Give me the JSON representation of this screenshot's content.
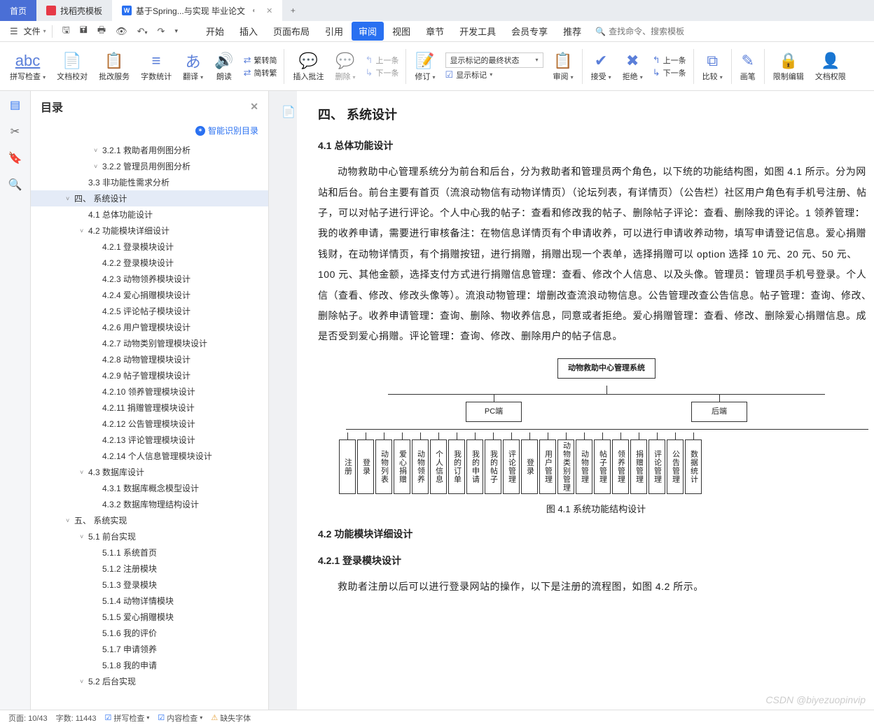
{
  "tabs": {
    "home": "首页",
    "t1": "找稻壳模板",
    "t2": "基于Spring...与实现 毕业论文",
    "indicator": "◐",
    "close": "✕",
    "new": "+"
  },
  "menubar": {
    "file": "文件",
    "items": [
      "开始",
      "插入",
      "页面布局",
      "引用",
      "审阅",
      "视图",
      "章节",
      "开发工具",
      "会员专享",
      "推荐"
    ],
    "active_index": 4,
    "search_placeholder": "查找命令、搜索模板"
  },
  "ribbon": {
    "spellcheck": "拼写检查",
    "proofread": "文档校对",
    "approve": "批改服务",
    "wordcount": "字数统计",
    "translate": "翻译",
    "read": "朗读",
    "convert": {
      "zh2tw": "繁转简",
      "tw2zh": "简转繁"
    },
    "insert_comment": "插入批注",
    "delete": "删除",
    "prev_comment": "上一条",
    "next_comment": "下一条",
    "revise": "修订",
    "markup_select": "显示标记的最终状态",
    "show_markup": "显示标记",
    "review": "审阅",
    "accept": "接受",
    "reject": "拒绝",
    "prev_rev": "上一条",
    "next_rev": "下一条",
    "compare": "比较",
    "pen": "画笔",
    "restrict": "限制编辑",
    "docperm": "文档权限"
  },
  "outline": {
    "title": "目录",
    "smart": "智能识别目录",
    "items": [
      {
        "level": 3,
        "text": "3.2.1 救助者用例图分析",
        "chev": "v"
      },
      {
        "level": 3,
        "text": "3.2.2 管理员用例图分析",
        "chev": "v"
      },
      {
        "level": 2,
        "text": "3.3 非功能性需求分析"
      },
      {
        "level": 1,
        "text": "四、 系统设计",
        "chev": "v",
        "selected": true
      },
      {
        "level": 2,
        "text": "4.1 总体功能设计"
      },
      {
        "level": 2,
        "text": "4.2 功能模块详细设计",
        "chev": "v"
      },
      {
        "level": 3,
        "text": "4.2.1 登录模块设计"
      },
      {
        "level": 3,
        "text": "4.2.2 登录模块设计"
      },
      {
        "level": 3,
        "text": "4.2.3 动物领养模块设计"
      },
      {
        "level": 3,
        "text": "4.2.4 爱心捐赠模块设计"
      },
      {
        "level": 3,
        "text": "4.2.5 评论帖子模块设计"
      },
      {
        "level": 3,
        "text": "4.2.6 用户管理模块设计"
      },
      {
        "level": 3,
        "text": "4.2.7 动物类别管理模块设计"
      },
      {
        "level": 3,
        "text": "4.2.8 动物管理模块设计"
      },
      {
        "level": 3,
        "text": "4.2.9 帖子管理模块设计"
      },
      {
        "level": 3,
        "text": "4.2.10 领养管理模块设计"
      },
      {
        "level": 3,
        "text": "4.2.11 捐赠管理模块设计"
      },
      {
        "level": 3,
        "text": "4.2.12 公告管理模块设计"
      },
      {
        "level": 3,
        "text": "4.2.13 评论管理模块设计"
      },
      {
        "level": 3,
        "text": "4.2.14 个人信息管理模块设计"
      },
      {
        "level": 2,
        "text": "4.3 数据库设计",
        "chev": "v"
      },
      {
        "level": 3,
        "text": "4.3.1 数据库概念模型设计"
      },
      {
        "level": 3,
        "text": "4.3.2 数据库物理结构设计"
      },
      {
        "level": 1,
        "text": "五、 系统实现",
        "chev": "v"
      },
      {
        "level": 2,
        "text": "5.1 前台实现",
        "chev": "v"
      },
      {
        "level": 3,
        "text": "5.1.1 系统首页"
      },
      {
        "level": 3,
        "text": "5.1.2 注册模块"
      },
      {
        "level": 3,
        "text": "5.1.3 登录模块"
      },
      {
        "level": 3,
        "text": "5.1.4 动物详情模块"
      },
      {
        "level": 3,
        "text": "5.1.5 爱心捐赠模块"
      },
      {
        "level": 3,
        "text": "5.1.6 我的评价"
      },
      {
        "level": 3,
        "text": "5.1.7 申请领养"
      },
      {
        "level": 3,
        "text": "5.1.8 我的申请"
      },
      {
        "level": 2,
        "text": "5.2 后台实现",
        "chev": "v"
      }
    ]
  },
  "doc": {
    "h2": "四、 系统设计",
    "h3_1": "4.1 总体功能设计",
    "p1": "动物救助中心管理系统分为前台和后台，分为救助者和管理员两个角色，以下统的功能结构图，如图 4.1 所示。分为网站和后台。前台主要有首页（流浪动物信有动物详情页）（论坛列表，有详情页）（公告栏）社区用户角色有手机号注册、帖子，可以对帖子进行评论。个人中心我的帖子：查看和修改我的帖子、删除帖子评论：查看、删除我的评论。1 领养管理：我的收养申请，需要进行审核备注：在物信息详情页有个申请收养，可以进行申请收养动物，填写申请登记信息。爱心捐赠钱财，在动物详情页，有个捐赠按钮，进行捐赠，捐赠出现一个表单，选择捐赠可以 option 选择 10 元、20 元、50 元、100 元、其他金额，选择支付方式进行捐赠信息管理：查看、修改个人信息、以及头像。管理员：管理员手机号登录。个人信（查看、修改、修改头像等）。流浪动物管理：增删改查流浪动物信息。公告管理改查公告信息。帖子管理：查询、修改、删除帖子。收养申请管理：查询、删除、物收养信息，同意或者拒绝。爱心捐赠管理：查看、修改、删除爱心捐赠信息。成是否受到爱心捐赠。评论管理：查询、修改、删除用户的帖子信息。",
    "diagram": {
      "root": "动物救助中心管理系统",
      "mid": [
        "PC端",
        "后端"
      ],
      "leaves": [
        "注册",
        "登录",
        "动物列表",
        "爱心捐赠",
        "动物领养",
        "个人信息",
        "我的订单",
        "我的申请",
        "我的帖子",
        "评论管理",
        "登录",
        "用户管理",
        "动物类别管理",
        "动物管理",
        "帖子管理",
        "领养管理",
        "捐赠管理",
        "评论管理",
        "公告管理",
        "数据统计"
      ]
    },
    "fig_caption": "图 4.1 系统功能结构设计",
    "h3_2": "4.2 功能模块详细设计",
    "h4_1": "4.2.1 登录模块设计",
    "p2": "救助者注册以后可以进行登录网站的操作，以下是注册的流程图，如图 4.2 所示。"
  },
  "statusbar": {
    "page": "页面: 10/43",
    "words": "字数: 11443",
    "spellcheck": "拼写检查",
    "contentcheck": "内容检查",
    "missingfont": "缺失字体"
  },
  "watermark": "CSDN @biyezuopinvip"
}
